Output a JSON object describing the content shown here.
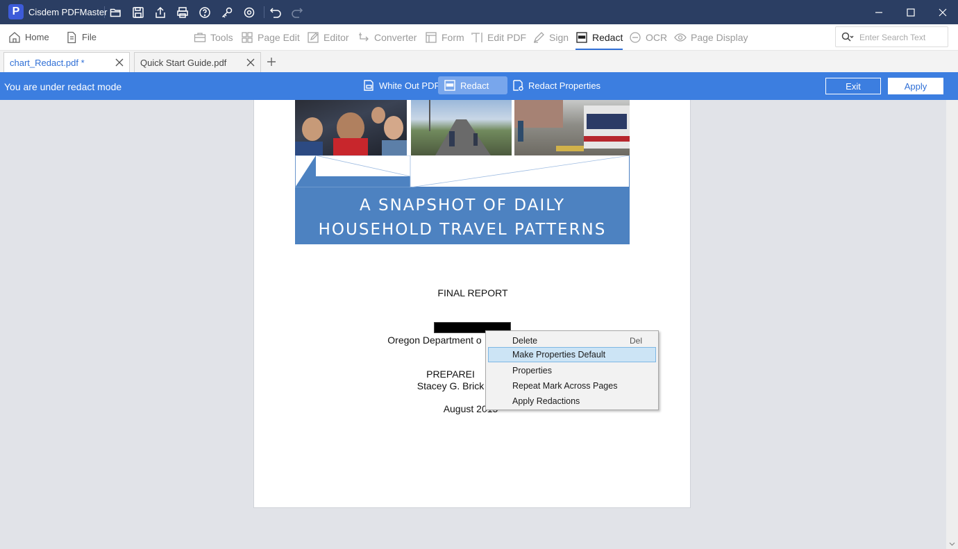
{
  "app": {
    "title": "Cisdem PDFMaster",
    "logo_letter": "P"
  },
  "quick_actions": [
    "open-folder",
    "save",
    "share",
    "print",
    "help",
    "key",
    "settings",
    "undo",
    "redo"
  ],
  "menu": {
    "home": "Home",
    "file": "File",
    "tools": "Tools",
    "page_edit": "Page Edit",
    "editor": "Editor",
    "converter": "Converter",
    "form": "Form",
    "edit_pdf": "Edit PDF",
    "sign": "Sign",
    "redact": "Redact",
    "ocr": "OCR",
    "page_display": "Page Display",
    "active": "Redact"
  },
  "search": {
    "placeholder": "Enter Search Text",
    "value": ""
  },
  "tabs": [
    {
      "label": "chart_Redact.pdf *",
      "active": true
    },
    {
      "label": "Quick Start Guide.pdf",
      "active": false
    }
  ],
  "redact_bar": {
    "mode_text": "You are under redact mode",
    "white_out": "White Out PDF",
    "redact": "Redact",
    "properties": "Redact Properties",
    "exit": "Exit",
    "apply": "Apply"
  },
  "document": {
    "banner_line1": "A SNAPSHOT OF DAILY",
    "banner_line2": "HOUSEHOLD TRAVEL PATTERNS",
    "final_report": "FINAL REPORT",
    "dept": "Oregon Department o",
    "prepared": "PREPAREI",
    "author": "Stacey G. Brick",
    "date": "August 2015"
  },
  "context_menu": {
    "items": [
      {
        "label": "Delete",
        "shortcut": "Del"
      },
      {
        "label": "Make Properties Default",
        "shortcut": ""
      },
      {
        "label": "Properties",
        "shortcut": ""
      },
      {
        "label": "Repeat Mark Across Pages",
        "shortcut": ""
      },
      {
        "label": "Apply Redactions",
        "shortcut": ""
      }
    ],
    "highlighted": "Make Properties Default"
  },
  "colors": {
    "titlebar": "#2b3e63",
    "redact_bar": "#3c7ee0",
    "accent": "#2f6fd6",
    "banner": "#4d82c1"
  }
}
